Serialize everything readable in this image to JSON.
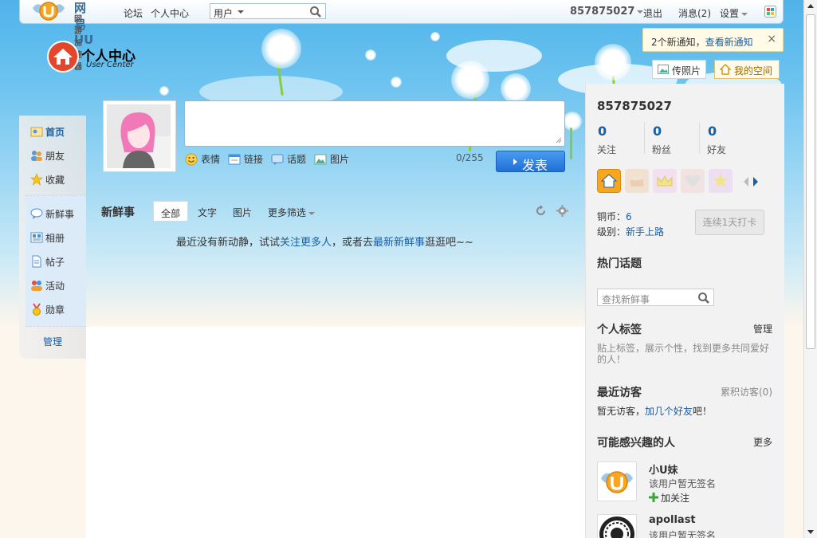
{
  "topbar": {
    "logo_line1": "网易UU",
    "logo_line2": "网游加速器",
    "nav": [
      "论坛",
      "个人中心"
    ],
    "search_scope": "用户",
    "account": "857875027",
    "logout": "退出",
    "messages": "消息(2)",
    "settings": "设置"
  },
  "notice": {
    "count_text": "2个新通知，",
    "link": "查看新通知",
    "close": "×"
  },
  "actions": {
    "photo": "传照片",
    "space": "我的空间"
  },
  "ucenter": {
    "title": "个人中心",
    "subtitle": "User Center"
  },
  "leftnav": {
    "items": [
      {
        "label": "首页",
        "icon": "home-icon"
      },
      {
        "label": "朋友",
        "icon": "friends-icon"
      },
      {
        "label": "收藏",
        "icon": "star-icon"
      },
      {
        "label": "新鲜事",
        "icon": "chat-icon"
      },
      {
        "label": "相册",
        "icon": "album-icon"
      },
      {
        "label": "帖子",
        "icon": "document-icon"
      },
      {
        "label": "活动",
        "icon": "activity-icon"
      },
      {
        "label": "勋章",
        "icon": "medal-icon"
      }
    ],
    "manage": "管理"
  },
  "composer": {
    "tools": [
      "表情",
      "链接",
      "话题",
      "图片"
    ],
    "counter": "0/255",
    "submit": "发表"
  },
  "feed": {
    "title": "新鲜事",
    "tabs": [
      "全部",
      "文字",
      "图片",
      "更多筛选"
    ],
    "empty_pre": "最近没有新动静，试试",
    "empty_link1": "关注更多人",
    "empty_mid": "，或者去",
    "empty_link2": "最新新鲜事",
    "empty_post": "逛逛吧~~"
  },
  "profile": {
    "name": "857875027",
    "stats": [
      {
        "value": "0",
        "label": "关注"
      },
      {
        "value": "0",
        "label": "粉丝"
      },
      {
        "value": "0",
        "label": "好友"
      }
    ],
    "coins_label": "铜币：",
    "coins_value": "6",
    "level_label": "级别：",
    "level_value": "新手上路",
    "checkin": "连续1天打卡"
  },
  "hot_topics": {
    "title": "热门话题",
    "search_placeholder": "查找新鲜事"
  },
  "tags": {
    "title": "个人标签",
    "manage": "管理",
    "hint": "贴上标签，展示个性，找到更多共同爱好的人！"
  },
  "visitors": {
    "title": "最近访客",
    "total": "累积访客(0)",
    "empty_pre": "暂无访客，",
    "empty_link": "加几个好友",
    "empty_post": "吧！"
  },
  "suggest": {
    "title": "可能感兴趣的人",
    "more": "更多",
    "people": [
      {
        "name": "小U妹",
        "sig": "该用户暂无签名",
        "follow": "加关注"
      },
      {
        "name": "apollast",
        "sig": "该用户暂无签名"
      }
    ]
  },
  "colors": {
    "accent": "#1a5fa3",
    "button": "#1f6fd6",
    "sky": "#6cc3ef"
  }
}
